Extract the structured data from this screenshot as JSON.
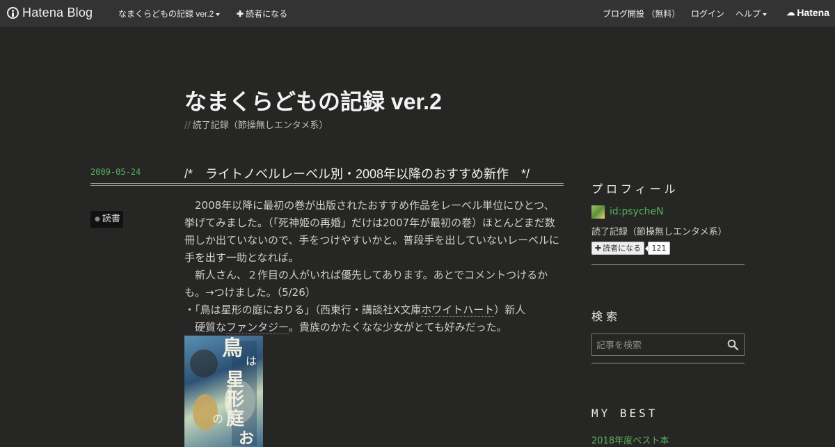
{
  "globalbar": {
    "brand": "Hatena Blog",
    "blog_menu": "なまくらどもの記録 ver.2",
    "subscribe": "読者になる",
    "open_blog": "ブログ開設 （無料）",
    "login": "ログイン",
    "help": "ヘルプ",
    "hatena": "Hatena"
  },
  "blog": {
    "title": "なまくらどもの記録 ver.2",
    "description_prefix": "//",
    "description": "読了記録（節操無しエンタメ系）"
  },
  "entry": {
    "date": "2009-05-24",
    "title": "/*　ライトノベルレーベル別・2008年以降のおすすめ新作　*/",
    "category": "読書",
    "para1": "　2008年以降に最初の巻が出版されたおすすめ作品をレーベル単位にひとつ、挙げてみました。（「死神姫の再婚」だけは2007年が最初の巻）ほとんどまだ数冊しか出ていないので、手をつけやすいかと。普段手を出していないレーベルに手を出す一助となれば。",
    "para2": "　新人さん、２作目の人がいれば優先してあります。あとでコメントつけるかも。→つけました。（5/26）",
    "item1_prefix": "・「鳥は星形の庭におりる」（西東行・講談社X文庫",
    "item1_keyword": "ホワイトハート",
    "item1_suffix": "）新人",
    "item1_desc_prefix": "　硬質な",
    "item1_desc_keyword": "ファンタジー",
    "item1_desc_suffix": "。貴族のかたくなな少女がとても好みだった。"
  },
  "sidebar": {
    "profile_heading": "プロフィール",
    "profile_id": "id:psycheN",
    "profile_desc": "読了記録（節操無しエンタメ系）",
    "subscribe_label": "読者になる",
    "subscriber_count": "121",
    "search_heading": "検索",
    "search_placeholder": "記事を検索",
    "best_heading": "MY BEST",
    "best_link": "2018年度ベスト本"
  },
  "colors": {
    "background": "#262624",
    "link_green": "#58b25f",
    "topbar": "#333333"
  }
}
